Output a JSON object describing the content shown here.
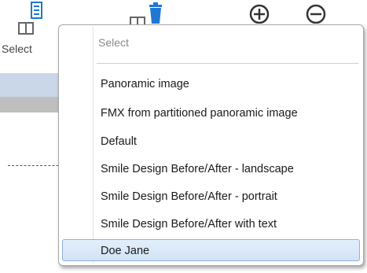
{
  "toolbar": {
    "select_label": "Select",
    "icons": [
      "layout-select-icon",
      "layout-delete-icon",
      "zoom-in-icon",
      "zoom-out-icon"
    ]
  },
  "menu": {
    "header": "Select",
    "items": [
      {
        "label": "Panoramic image",
        "selected": false
      },
      {
        "label": "FMX from partitioned panoramic image",
        "selected": false
      },
      {
        "label": "Default",
        "selected": false
      },
      {
        "label": "Smile Design Before/After - landscape",
        "selected": false
      },
      {
        "label": "Smile Design Before/After - portrait",
        "selected": false
      },
      {
        "label": "Smile Design Before/After with text",
        "selected": false
      },
      {
        "label": "Doe Jane",
        "selected": true
      }
    ]
  },
  "colors": {
    "icon_blue": "#1f78d1",
    "highlight_bg": "#d2e3f7",
    "highlight_border": "#8ab2e0"
  }
}
